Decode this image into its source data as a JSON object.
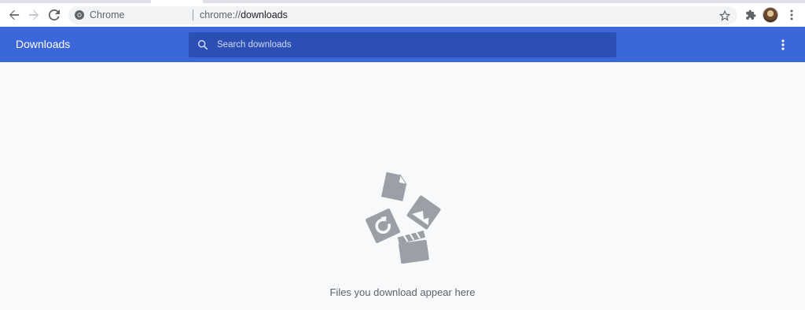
{
  "browser": {
    "chip_label": "Chrome",
    "url_scheme": "chrome://",
    "url_path": "downloads"
  },
  "header": {
    "title": "Downloads",
    "search_placeholder": "Search downloads"
  },
  "main": {
    "empty_message": "Files you download appear here"
  },
  "icons": {
    "back": "arrow-back-icon",
    "forward": "arrow-forward-icon",
    "reload": "reload-icon",
    "site": "chrome-icon",
    "bookmark": "star-icon",
    "extensions": "puzzle-icon",
    "menu": "more-vert-icon",
    "search": "search-icon",
    "illustration": "empty-downloads-illustration"
  },
  "colors": {
    "header_bg": "#3b67d9",
    "search_bg": "#2c4fb5",
    "main_bg": "#f8f9fa",
    "illustration": "#9aa0a6"
  }
}
